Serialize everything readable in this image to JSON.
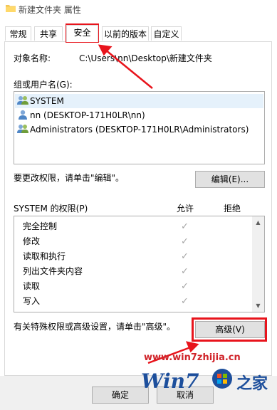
{
  "window": {
    "title": "新建文件夹 属性"
  },
  "tabs": [
    {
      "label": "常规"
    },
    {
      "label": "共享"
    },
    {
      "label": "安全"
    },
    {
      "label": "以前的版本"
    },
    {
      "label": "自定义"
    }
  ],
  "security": {
    "object_name_label": "对象名称:",
    "object_name_value": "C:\\Users\\nn\\Desktop\\新建文件夹",
    "group_label": "组或用户名(G):",
    "users": [
      {
        "name": "SYSTEM"
      },
      {
        "name": "nn (DESKTOP-171H0LR\\nn)"
      },
      {
        "name": "Administrators (DESKTOP-171H0LR\\Administrators)"
      }
    ],
    "edit_hint": "要更改权限，请单击\"编辑\"。",
    "edit_button": "编辑(E)...",
    "permissions_label": "SYSTEM 的权限(P)",
    "allow_header": "允许",
    "deny_header": "拒绝",
    "permissions": [
      {
        "name": "完全控制"
      },
      {
        "name": "修改"
      },
      {
        "name": "读取和执行"
      },
      {
        "name": "列出文件夹内容"
      },
      {
        "name": "读取"
      },
      {
        "name": "写入"
      }
    ],
    "advanced_hint": "有关特殊权限或高级设置，请单击\"高级\"。",
    "advanced_button": "高级(V)"
  },
  "footer": {
    "ok_button": "确定",
    "cancel_button": "取消"
  },
  "watermark": {
    "url": "www.win7zhijia.cn",
    "logo_text": "Win7",
    "logo_suffix": "之家"
  },
  "colors": {
    "annotation_red": "#e8141c",
    "selection": "#e5f1fb"
  }
}
